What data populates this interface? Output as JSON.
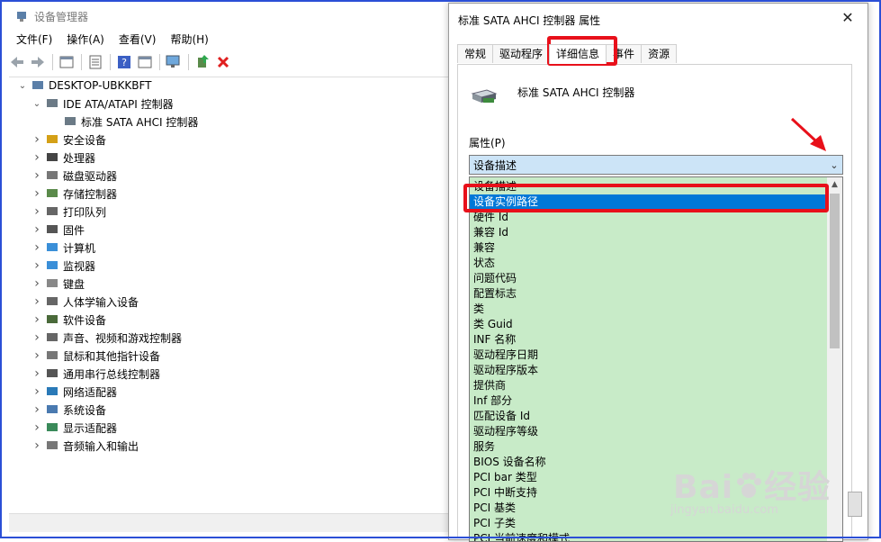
{
  "device_manager": {
    "title": "设备管理器",
    "menu": [
      "文件(F)",
      "操作(A)",
      "查看(V)",
      "帮助(H)"
    ],
    "tree": [
      {
        "label": "DESKTOP-UBKKBFT",
        "level": 0,
        "expanded": true,
        "icon": "computer-icon"
      },
      {
        "label": "IDE ATA/ATAPI 控制器",
        "level": 1,
        "expanded": true,
        "icon": "ide-controller-icon"
      },
      {
        "label": "标准 SATA AHCI 控制器",
        "level": 2,
        "expanded": null,
        "icon": "ide-controller-icon"
      },
      {
        "label": "安全设备",
        "level": 1,
        "expanded": false,
        "icon": "key-icon"
      },
      {
        "label": "处理器",
        "level": 1,
        "expanded": false,
        "icon": "cpu-icon"
      },
      {
        "label": "磁盘驱动器",
        "level": 1,
        "expanded": false,
        "icon": "disk-icon"
      },
      {
        "label": "存储控制器",
        "level": 1,
        "expanded": false,
        "icon": "storage-icon"
      },
      {
        "label": "打印队列",
        "level": 1,
        "expanded": false,
        "icon": "printer-icon"
      },
      {
        "label": "固件",
        "level": 1,
        "expanded": false,
        "icon": "firmware-icon"
      },
      {
        "label": "计算机",
        "level": 1,
        "expanded": false,
        "icon": "monitor-icon"
      },
      {
        "label": "监视器",
        "level": 1,
        "expanded": false,
        "icon": "monitor-icon"
      },
      {
        "label": "键盘",
        "level": 1,
        "expanded": false,
        "icon": "keyboard-icon"
      },
      {
        "label": "人体学输入设备",
        "level": 1,
        "expanded": false,
        "icon": "hid-icon"
      },
      {
        "label": "软件设备",
        "level": 1,
        "expanded": false,
        "icon": "software-device-icon"
      },
      {
        "label": "声音、视频和游戏控制器",
        "level": 1,
        "expanded": false,
        "icon": "speaker-icon"
      },
      {
        "label": "鼠标和其他指针设备",
        "level": 1,
        "expanded": false,
        "icon": "mouse-icon"
      },
      {
        "label": "通用串行总线控制器",
        "level": 1,
        "expanded": false,
        "icon": "usb-icon"
      },
      {
        "label": "网络适配器",
        "level": 1,
        "expanded": false,
        "icon": "network-icon"
      },
      {
        "label": "系统设备",
        "level": 1,
        "expanded": false,
        "icon": "system-icon"
      },
      {
        "label": "显示适配器",
        "level": 1,
        "expanded": false,
        "icon": "display-adapter-icon"
      },
      {
        "label": "音频输入和输出",
        "level": 1,
        "expanded": false,
        "icon": "audio-icon"
      }
    ]
  },
  "dialog": {
    "title": "标准 SATA AHCI 控制器 属性",
    "close_glyph": "✕",
    "tabs": [
      "常规",
      "驱动程序",
      "详细信息",
      "事件",
      "资源"
    ],
    "active_tab": "详细信息",
    "device_name": "标准 SATA AHCI 控制器",
    "property_label": "属性(P)",
    "property_selected": "设备描述",
    "highlighted_option": "设备实例路径",
    "options": [
      "设备描述",
      "设备实例路径",
      "硬件 Id",
      "兼容 Id",
      "兼容",
      "状态",
      "问题代码",
      "配置标志",
      "类",
      "类 Guid",
      "INF 名称",
      "驱动程序日期",
      "驱动程序版本",
      "提供商",
      "Inf 部分",
      "匹配设备 Id",
      "驱动程序等级",
      "服务",
      "BIOS 设备名称",
      "PCI bar 类型",
      "PCI 中断支持",
      "PCI 基类",
      "PCI 子类",
      "PCI 当前速度和模式"
    ]
  },
  "colors": {
    "highlight": "#e8101a",
    "selection": "#0078d7",
    "list_bg": "#c8ebc8",
    "combo_bg": "#cce4f7"
  },
  "watermark": {
    "brand": "Bai",
    "brand2": "经验",
    "url": "jingyan.baidu.com"
  }
}
